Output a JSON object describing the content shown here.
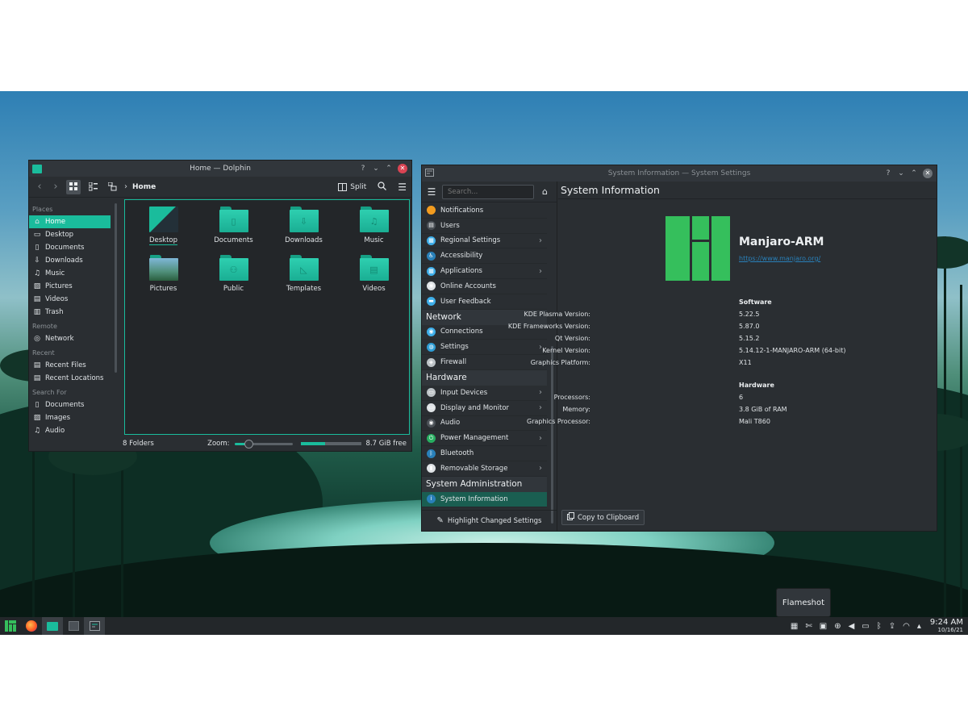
{
  "dolphin": {
    "title": "Home — Dolphin",
    "breadcrumb": "Home",
    "split_label": "Split",
    "places_header": "Places",
    "places": [
      {
        "label": "Home",
        "icon": "home-icon"
      },
      {
        "label": "Desktop",
        "icon": "desktop-icon"
      },
      {
        "label": "Documents",
        "icon": "documents-icon"
      },
      {
        "label": "Downloads",
        "icon": "downloads-icon"
      },
      {
        "label": "Music",
        "icon": "music-icon"
      },
      {
        "label": "Pictures",
        "icon": "pictures-icon"
      },
      {
        "label": "Videos",
        "icon": "videos-icon"
      },
      {
        "label": "Trash",
        "icon": "trash-icon"
      }
    ],
    "remote_header": "Remote",
    "remote": [
      {
        "label": "Network",
        "icon": "network-icon"
      }
    ],
    "recent_header": "Recent",
    "recent": [
      {
        "label": "Recent Files",
        "icon": "recent-files-icon"
      },
      {
        "label": "Recent Locations",
        "icon": "recent-locations-icon"
      }
    ],
    "search_header": "Search For",
    "search_for": [
      {
        "label": "Documents",
        "icon": "documents-icon"
      },
      {
        "label": "Images",
        "icon": "images-icon"
      },
      {
        "label": "Audio",
        "icon": "audio-icon"
      }
    ],
    "files": [
      {
        "name": "Desktop",
        "glyph": ""
      },
      {
        "name": "Documents",
        "glyph": "▯"
      },
      {
        "name": "Downloads",
        "glyph": "⇩"
      },
      {
        "name": "Music",
        "glyph": "♫"
      },
      {
        "name": "Pictures",
        "glyph": ""
      },
      {
        "name": "Public",
        "glyph": "⚇"
      },
      {
        "name": "Templates",
        "glyph": "◺"
      },
      {
        "name": "Videos",
        "glyph": "▤"
      }
    ],
    "status_count": "8 Folders",
    "zoom_label": "Zoom:",
    "zoom_level": 0.22,
    "disk_used_fraction": 0.4,
    "free_space": "8.7 GiB free"
  },
  "settings": {
    "title": "System Information — System Settings",
    "search_placeholder": "Search...",
    "page_title": "System Information",
    "footer_button": "Highlight Changed Settings",
    "sections": [
      {
        "category": "",
        "items": [
          {
            "label": "Notifications",
            "icon": "bell-icon",
            "color": "#f39c1f",
            "arrow": false
          },
          {
            "label": "Users",
            "icon": "users-icon",
            "color": "#4b5157",
            "arrow": false
          },
          {
            "label": "Regional Settings",
            "icon": "regional-icon",
            "color": "#3daee9",
            "arrow": true
          },
          {
            "label": "Accessibility",
            "icon": "accessibility-icon",
            "color": "#2980b9",
            "arrow": false
          },
          {
            "label": "Applications",
            "icon": "applications-icon",
            "color": "#3daee9",
            "arrow": true
          },
          {
            "label": "Online Accounts",
            "icon": "online-accounts-icon",
            "color": "#dfe3e6",
            "arrow": false
          },
          {
            "label": "User Feedback",
            "icon": "feedback-icon",
            "color": "#3daee9",
            "arrow": false
          }
        ]
      },
      {
        "category": "Network",
        "items": [
          {
            "label": "Connections",
            "icon": "connections-icon",
            "color": "#3daee9",
            "arrow": false
          },
          {
            "label": "Settings",
            "icon": "network-settings-icon",
            "color": "#2e9ed6",
            "arrow": true
          },
          {
            "label": "Firewall",
            "icon": "firewall-icon",
            "color": "#bdc3c7",
            "arrow": false
          }
        ]
      },
      {
        "category": "Hardware",
        "items": [
          {
            "label": "Input Devices",
            "icon": "input-devices-icon",
            "color": "#bdc3c7",
            "arrow": true
          },
          {
            "label": "Display and Monitor",
            "icon": "display-icon",
            "color": "#dfe3e6",
            "arrow": true
          },
          {
            "label": "Audio",
            "icon": "audio-icon",
            "color": "#4b5157",
            "arrow": false
          },
          {
            "label": "Power Management",
            "icon": "power-icon",
            "color": "#27ae60",
            "arrow": true
          },
          {
            "label": "Bluetooth",
            "icon": "bluetooth-icon",
            "color": "#2980b9",
            "arrow": false
          },
          {
            "label": "Removable Storage",
            "icon": "usb-icon",
            "color": "#dfe3e6",
            "arrow": true
          }
        ]
      },
      {
        "category": "System Administration",
        "items": [
          {
            "label": "System Information",
            "icon": "info-icon",
            "color": "#2980b9",
            "arrow": false,
            "selected": true
          }
        ]
      }
    ],
    "os_name": "Manjaro-ARM",
    "os_url": "https://www.manjaro.org/",
    "software_header": "Software",
    "software": [
      {
        "key": "KDE Plasma Version:",
        "value": "5.22.5"
      },
      {
        "key": "KDE Frameworks Version:",
        "value": "5.87.0"
      },
      {
        "key": "Qt Version:",
        "value": "5.15.2"
      },
      {
        "key": "Kernel Version:",
        "value": "5.14.12-1-MANJARO-ARM (64-bit)"
      },
      {
        "key": "Graphics Platform:",
        "value": "X11"
      }
    ],
    "hardware_header": "Hardware",
    "hardware": [
      {
        "key": "Processors:",
        "value": "6"
      },
      {
        "key": "Memory:",
        "value": "3.8 GiB of RAM"
      },
      {
        "key": "Graphics Processor:",
        "value": "Mali T860"
      }
    ],
    "copy_button": "Copy to Clipboard"
  },
  "taskbar": {
    "tooltip": "Flameshot",
    "time": "9:24 AM",
    "date": "10/16/21"
  },
  "colors": {
    "accent": "#1abc9c",
    "manjaro_green": "#35bf5c",
    "window_bg": "#2a2e32",
    "close_red": "#da4453"
  }
}
